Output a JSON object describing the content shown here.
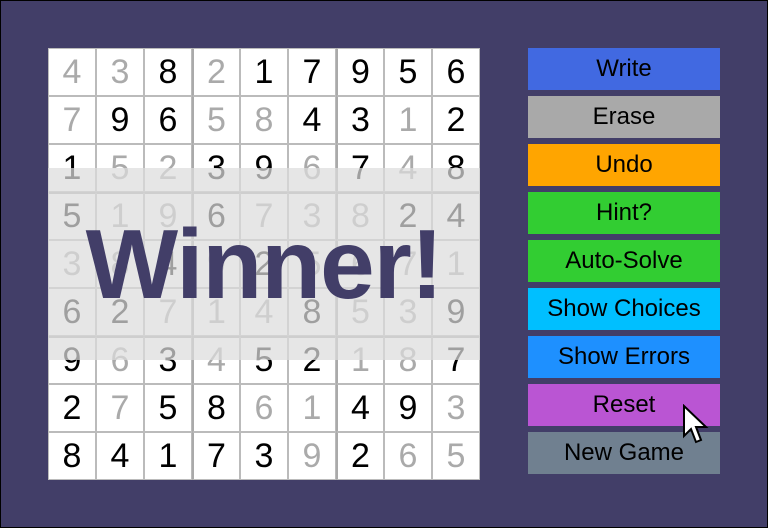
{
  "grid": {
    "rows": [
      [
        [
          "4",
          1
        ],
        [
          "3",
          1
        ],
        [
          "8",
          0
        ],
        [
          "2",
          1
        ],
        [
          "1",
          0
        ],
        [
          "7",
          0
        ],
        [
          "9",
          0
        ],
        [
          "5",
          0
        ],
        [
          "6",
          0
        ]
      ],
      [
        [
          "7",
          1
        ],
        [
          "9",
          0
        ],
        [
          "6",
          0
        ],
        [
          "5",
          1
        ],
        [
          "8",
          1
        ],
        [
          "4",
          0
        ],
        [
          "3",
          0
        ],
        [
          "1",
          1
        ],
        [
          "2",
          0
        ]
      ],
      [
        [
          "1",
          0
        ],
        [
          "5",
          1
        ],
        [
          "2",
          1
        ],
        [
          "3",
          0
        ],
        [
          "9",
          0
        ],
        [
          "6",
          1
        ],
        [
          "7",
          0
        ],
        [
          "4",
          1
        ],
        [
          "8",
          0
        ]
      ],
      [
        [
          "5",
          0
        ],
        [
          "1",
          1
        ],
        [
          "9",
          1
        ],
        [
          "6",
          0
        ],
        [
          "7",
          1
        ],
        [
          "3",
          1
        ],
        [
          "8",
          1
        ],
        [
          "2",
          0
        ],
        [
          "4",
          0
        ]
      ],
      [
        [
          "3",
          1
        ],
        [
          "8",
          1
        ],
        [
          "4",
          0
        ],
        [
          "9",
          1
        ],
        [
          "2",
          0
        ],
        [
          "5",
          1
        ],
        [
          "6",
          1
        ],
        [
          "7",
          1
        ],
        [
          "1",
          1
        ]
      ],
      [
        [
          "6",
          0
        ],
        [
          "2",
          0
        ],
        [
          "7",
          1
        ],
        [
          "1",
          1
        ],
        [
          "4",
          1
        ],
        [
          "8",
          0
        ],
        [
          "5",
          1
        ],
        [
          "3",
          1
        ],
        [
          "9",
          0
        ]
      ],
      [
        [
          "9",
          0
        ],
        [
          "6",
          1
        ],
        [
          "3",
          0
        ],
        [
          "4",
          1
        ],
        [
          "5",
          0
        ],
        [
          "2",
          0
        ],
        [
          "1",
          1
        ],
        [
          "8",
          1
        ],
        [
          "7",
          0
        ]
      ],
      [
        [
          "2",
          0
        ],
        [
          "7",
          1
        ],
        [
          "5",
          0
        ],
        [
          "8",
          0
        ],
        [
          "6",
          1
        ],
        [
          "1",
          1
        ],
        [
          "4",
          0
        ],
        [
          "9",
          0
        ],
        [
          "3",
          1
        ]
      ],
      [
        [
          "8",
          0
        ],
        [
          "4",
          0
        ],
        [
          "1",
          0
        ],
        [
          "7",
          0
        ],
        [
          "3",
          0
        ],
        [
          "9",
          1
        ],
        [
          "2",
          0
        ],
        [
          "6",
          1
        ],
        [
          "5",
          1
        ]
      ]
    ]
  },
  "overlay": {
    "text": "Winner!"
  },
  "buttons": [
    {
      "label": "Write",
      "color": "#4169e1"
    },
    {
      "label": "Erase",
      "color": "#a9a9a9"
    },
    {
      "label": "Undo",
      "color": "#ffa500"
    },
    {
      "label": "Hint?",
      "color": "#32cd32"
    },
    {
      "label": "Auto-Solve",
      "color": "#32cd32"
    },
    {
      "label": "Show Choices",
      "color": "#00bfff"
    },
    {
      "label": "Show Errors",
      "color": "#1e90ff"
    },
    {
      "label": "Reset",
      "color": "#ba55d3"
    },
    {
      "label": "New Game",
      "color": "#708090"
    }
  ],
  "colors": {
    "background": "#423e68",
    "given": "#000000",
    "entered": "#aaaaaa"
  }
}
